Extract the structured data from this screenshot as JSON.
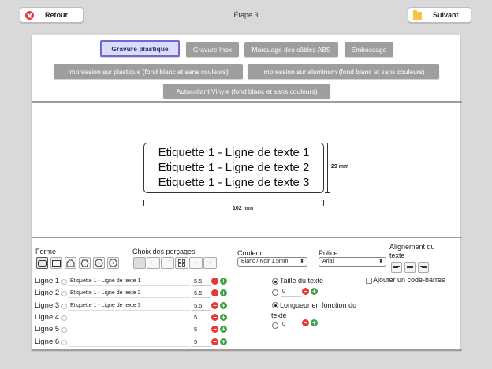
{
  "header": {
    "back_label": "Retour",
    "next_label": "Suivant",
    "step_title": "Étape 3"
  },
  "tabs": {
    "row1": [
      "Gravure plastique",
      "Gravure Inox",
      "Marquage des câbles ABS",
      "Embossage"
    ],
    "row2": [
      "Impression sur plastique (fond blanc et sans couleurs)",
      "Impression sur aluminum (fond blanc et sans couleurs)"
    ],
    "row3": [
      "Autocollant Vinyle (fond blanc et sans couleurs)"
    ],
    "active": "Gravure plastique"
  },
  "preview": {
    "lines": [
      "Etiquette 1 - Ligne de texte  1",
      "Etiquette 1 - Ligne de texte 2",
      "Etiquette 1 - Ligne de texte 3"
    ],
    "height_label": "29 mm",
    "width_label": "102 mm"
  },
  "controls": {
    "forme_label": "Forme",
    "drill_label": "Choix des perçages",
    "color_label": "Couleur",
    "color_value": "Blanc / Noir 1.5mm",
    "font_label": "Police",
    "font_value": "Arial",
    "align_label": "Alignement du texte",
    "barcode_label": "Ajouter un code-barres",
    "text_size_label": "Taille du texte",
    "text_size_value": "0",
    "length_label": "Longueur en fonction du texte",
    "length_value": "0"
  },
  "lines": [
    {
      "label": "Ligne 1",
      "text": "Etiquette 1 - Ligne de texte  1",
      "size": "5.5"
    },
    {
      "label": "Ligne 2",
      "text": "Etiquette 1 - Ligne de texte 2",
      "size": "5.5"
    },
    {
      "label": "Ligne 3",
      "text": "Etiquette 1 - Ligne de texte 3",
      "size": "5.5"
    },
    {
      "label": "Ligne 4",
      "text": "",
      "size": "5"
    },
    {
      "label": "Ligne 5",
      "text": "",
      "size": "5"
    },
    {
      "label": "Ligne 6",
      "text": "",
      "size": "5"
    }
  ],
  "colors": {
    "active_tab_border": "#6b6bd6",
    "tab_bg": "#9e9e9e",
    "minus": "#e53935",
    "plus": "#43a047"
  }
}
